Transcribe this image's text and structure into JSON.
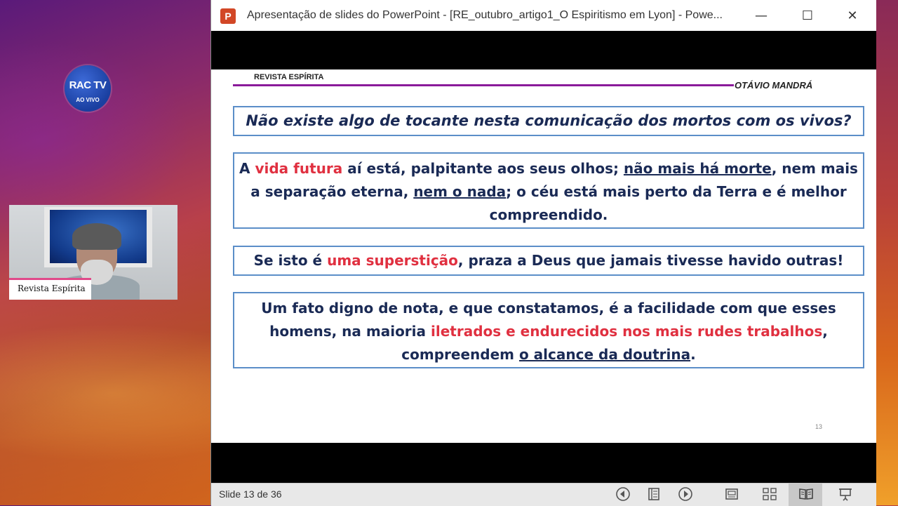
{
  "logo": {
    "brand": "RAC TV",
    "tagline": "AO VIVO"
  },
  "webcam": {
    "name_label": "Revista Espírita"
  },
  "window": {
    "title": "Apresentação de slides do PowerPoint - [RE_outubro_artigo1_O Espiritismo em Lyon] - Powe...",
    "minimize": "—",
    "maximize": "☐",
    "close": "✕"
  },
  "slide": {
    "header_left": "REVISTA ESPÍRITA",
    "header_right": "OTÁVIO MANDRÁ",
    "box1": "Não existe algo de tocante nesta comunicação dos mortos com os vivos?",
    "box2": {
      "p1": "A ",
      "p2_red": "vida futura",
      "p3": " aí está, palpitante aos seus olhos; ",
      "p4_u": "não mais há morte",
      "p5": ", nem mais a separação eterna, ",
      "p6_u": "nem o nada",
      "p7": "; o céu está mais perto da Terra e é melhor compreendido."
    },
    "box3": {
      "p1": "Se isto é ",
      "p2_red": "uma superstição",
      "p3": ", praza a Deus que jamais tivesse havido outras!"
    },
    "box4": {
      "p1": "Um fato digno de nota, e que constatamos, é a facilidade com que esses homens, na maioria ",
      "p2_red": "iletrados e endurecidos nos mais rudes trabalhos",
      "p3": ", compreendem ",
      "p4_u": "o alcance da doutrina",
      "p5": "."
    },
    "number": "13"
  },
  "status": {
    "slide_counter": "Slide 13 de 36"
  },
  "colors": {
    "accent_red": "#e03040",
    "text_navy": "#1a2a55",
    "box_border": "#5b8ec8",
    "header_line": "#8a1a9a",
    "ppt_icon": "#d24726"
  },
  "icons": [
    "prev-slide-icon",
    "slide-menu-icon",
    "next-slide-icon",
    "normal-view-icon",
    "slide-sorter-icon",
    "reading-view-icon",
    "slideshow-icon"
  ]
}
